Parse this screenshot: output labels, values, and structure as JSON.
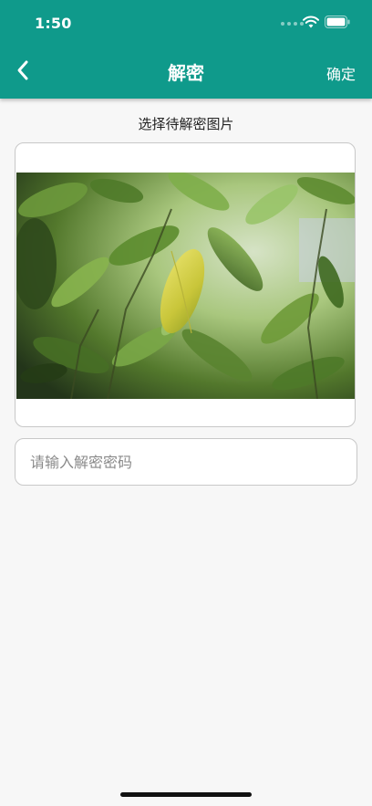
{
  "status_bar": {
    "time": "1:50"
  },
  "header": {
    "title": "解密",
    "confirm_label": "确定",
    "back_icon": "chevron-left-icon"
  },
  "main": {
    "section_label": "选择待解密图片",
    "password_placeholder": "请输入解密密码"
  },
  "colors": {
    "accent": "#0f9a8b",
    "background": "#f7f7f7"
  }
}
